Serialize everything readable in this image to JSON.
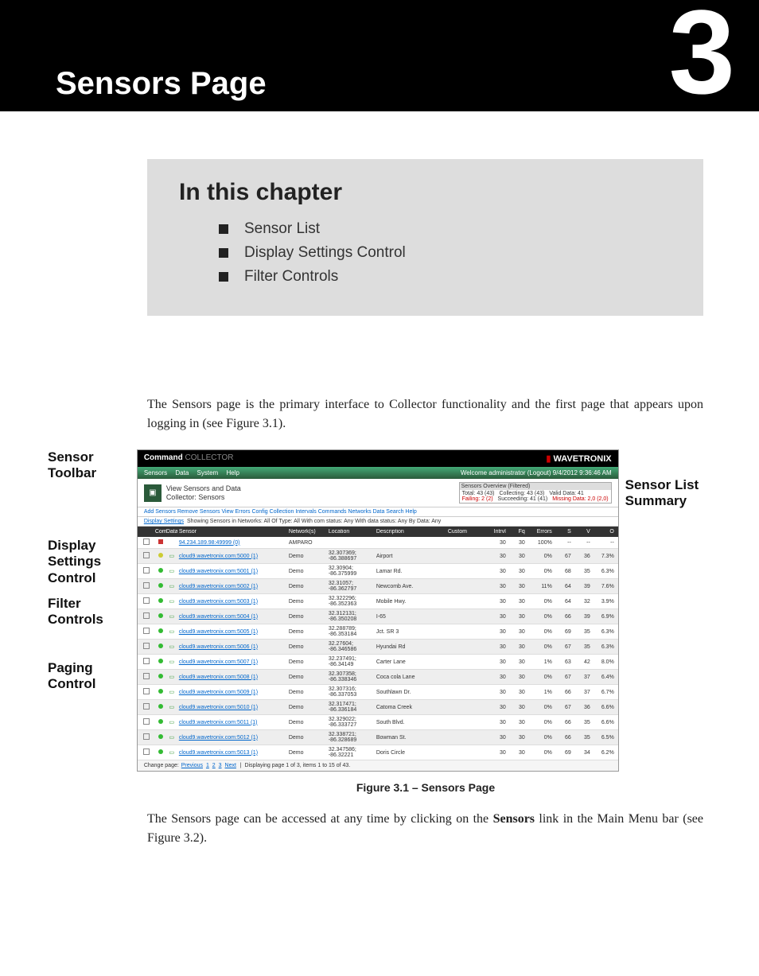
{
  "chapter": {
    "number": "3",
    "title": "Sensors Page",
    "in_this_chapter_heading": "In this chapter",
    "items": [
      "Sensor List",
      "Display Settings Control",
      "Filter Controls"
    ]
  },
  "callouts": {
    "sensor_toolbar": "Sensor Toolbar",
    "display_settings_control": "Display Settings Control",
    "filter_controls": "Filter Controls",
    "paging_control": "Paging Control",
    "sensor_list_summary": "Sensor List Summary"
  },
  "body": {
    "p1": "The Sensors page is the primary interface to Collector functionality and the first page that appears upon logging in (see Figure 3.1).",
    "p2a": "The Sensors page can be accessed at any time by clicking on the ",
    "p2_bold": "Sensors",
    "p2b": " link in the Main Menu bar (see Figure 3.2).",
    "figure_caption": "Figure 3.1 – Sensors Page"
  },
  "app": {
    "title_brand": "Command",
    "title_sub": "COLLECTOR",
    "logo_text": "WAVETRONIX",
    "menu": [
      "Sensors",
      "Data",
      "System",
      "Help"
    ],
    "welcome": "Welcome administrator (Logout) 9/4/2012 9:36:46 AM",
    "view_sensors_line1": "View Sensors and Data",
    "view_sensors_line2": "Collector: Sensors",
    "overview": {
      "heading": "Sensors Overview (Filtered)",
      "total": "Total: 43 (43)",
      "collecting": "Collecting: 43 (43)",
      "valid": "Valid Data: 41",
      "failing": "Failing: 2 (2)",
      "succeeding": "Succeeding: 41 (41)",
      "missing": "Missing Data: 2,0 (2,0)"
    },
    "toolbar": "Add Sensors  Remove Sensors  View Errors  Config  Collection  Intervals  Commands  Networks  Data  Search  Help",
    "filter_label": "Display Settings",
    "filter_text": "Showing Sensors in Networks: All  Of Type: All  With com status: Any  With data status: Any  By Data: Any",
    "columns": [
      "",
      "Com",
      "Data",
      "Sensor",
      "Network(s)",
      "Location",
      "Description",
      "Custom",
      "Intrvl",
      "Fq",
      "Errors",
      "S",
      "V",
      "O"
    ],
    "rows": [
      {
        "chk": true,
        "com": "r",
        "data": "",
        "sensor": "94.234.189.98:49999 (0)",
        "net": "AMPARO",
        "loc": "",
        "desc": "",
        "intvl": "30",
        "fq": "30",
        "err": "100%",
        "s": "--",
        "v": "--",
        "o": "--"
      },
      {
        "chk": true,
        "com": "y",
        "data": "s",
        "sensor": "cloud9.wavetronix.com:5000 (1)",
        "net": "Demo",
        "loc": "32.307369; -86.388697",
        "desc": "Airport",
        "intvl": "30",
        "fq": "30",
        "err": "0%",
        "s": "67",
        "v": "36",
        "o": "7.3%"
      },
      {
        "chk": true,
        "com": "g",
        "data": "s",
        "sensor": "cloud9.wavetronix.com:5001 (1)",
        "net": "Demo",
        "loc": "32.30904; -86.375999",
        "desc": "Lamar Rd.",
        "intvl": "30",
        "fq": "30",
        "err": "0%",
        "s": "68",
        "v": "35",
        "o": "6.3%"
      },
      {
        "chk": true,
        "com": "g",
        "data": "s",
        "sensor": "cloud9.wavetronix.com:5002 (1)",
        "net": "Demo",
        "loc": "32.31057; -86.362797",
        "desc": "Newcomb Ave.",
        "intvl": "30",
        "fq": "30",
        "err": "11%",
        "s": "64",
        "v": "39",
        "o": "7.6%"
      },
      {
        "chk": true,
        "com": "g",
        "data": "s",
        "sensor": "cloud9.wavetronix.com:5003 (1)",
        "net": "Demo",
        "loc": "32.322296; -86.352363",
        "desc": "Mobile Hwy.",
        "intvl": "30",
        "fq": "30",
        "err": "0%",
        "s": "64",
        "v": "32",
        "o": "3.9%"
      },
      {
        "chk": true,
        "com": "g",
        "data": "s",
        "sensor": "cloud9.wavetronix.com:5004 (1)",
        "net": "Demo",
        "loc": "32.312131; -86.350208",
        "desc": "I-65",
        "intvl": "30",
        "fq": "30",
        "err": "0%",
        "s": "66",
        "v": "39",
        "o": "6.9%"
      },
      {
        "chk": true,
        "com": "g",
        "data": "s",
        "sensor": "cloud9.wavetronix.com:5005 (1)",
        "net": "Demo",
        "loc": "32.288789; -86.353184",
        "desc": "Jct. SR 3",
        "intvl": "30",
        "fq": "30",
        "err": "0%",
        "s": "69",
        "v": "35",
        "o": "6.3%"
      },
      {
        "chk": true,
        "com": "g",
        "data": "s",
        "sensor": "cloud9.wavetronix.com:5006 (1)",
        "net": "Demo",
        "loc": "32.27604; -86.346586",
        "desc": "Hyundai Rd",
        "intvl": "30",
        "fq": "30",
        "err": "0%",
        "s": "67",
        "v": "35",
        "o": "6.3%"
      },
      {
        "chk": true,
        "com": "g",
        "data": "s",
        "sensor": "cloud9.wavetronix.com:5007 (1)",
        "net": "Demo",
        "loc": "32.237491; -86.34149",
        "desc": "Carter Lane",
        "intvl": "30",
        "fq": "30",
        "err": "1%",
        "s": "63",
        "v": "42",
        "o": "8.0%"
      },
      {
        "chk": true,
        "com": "g",
        "data": "s",
        "sensor": "cloud9.wavetronix.com:5008 (1)",
        "net": "Demo",
        "loc": "32.307358; -86.338346",
        "desc": "Coca cola Lane",
        "intvl": "30",
        "fq": "30",
        "err": "0%",
        "s": "67",
        "v": "37",
        "o": "6.4%"
      },
      {
        "chk": true,
        "com": "g",
        "data": "s",
        "sensor": "cloud9.wavetronix.com:5009 (1)",
        "net": "Demo",
        "loc": "32.307316; -86.337053",
        "desc": "Southlawn Dr.",
        "intvl": "30",
        "fq": "30",
        "err": "1%",
        "s": "66",
        "v": "37",
        "o": "6.7%"
      },
      {
        "chk": true,
        "com": "g",
        "data": "s",
        "sensor": "cloud9.wavetronix.com:5010 (1)",
        "net": "Demo",
        "loc": "32.317471; -86.336184",
        "desc": "Catoma Creek",
        "intvl": "30",
        "fq": "30",
        "err": "0%",
        "s": "67",
        "v": "36",
        "o": "6.6%"
      },
      {
        "chk": true,
        "com": "g",
        "data": "s",
        "sensor": "cloud9.wavetronix.com:5011 (1)",
        "net": "Demo",
        "loc": "32.329022; -86.333727",
        "desc": "South Blvd.",
        "intvl": "30",
        "fq": "30",
        "err": "0%",
        "s": "66",
        "v": "35",
        "o": "6.6%"
      },
      {
        "chk": true,
        "com": "g",
        "data": "s",
        "sensor": "cloud9.wavetronix.com:5012 (1)",
        "net": "Demo",
        "loc": "32.338721; -86.328689",
        "desc": "Bowman St.",
        "intvl": "30",
        "fq": "30",
        "err": "0%",
        "s": "66",
        "v": "35",
        "o": "6.5%"
      },
      {
        "chk": true,
        "com": "g",
        "data": "s",
        "sensor": "cloud9.wavetronix.com:5013 (1)",
        "net": "Demo",
        "loc": "32.347586; -86.32221",
        "desc": "Doris Circle",
        "intvl": "30",
        "fq": "30",
        "err": "0%",
        "s": "69",
        "v": "34",
        "o": "6.2%"
      }
    ],
    "paging_prefix": "Change page:",
    "paging_prev": "Previous",
    "paging_pages": [
      "1",
      "2",
      "3"
    ],
    "paging_next": "Next",
    "paging_status": "Displaying page 1 of 3, items 1 to 15 of 43."
  }
}
